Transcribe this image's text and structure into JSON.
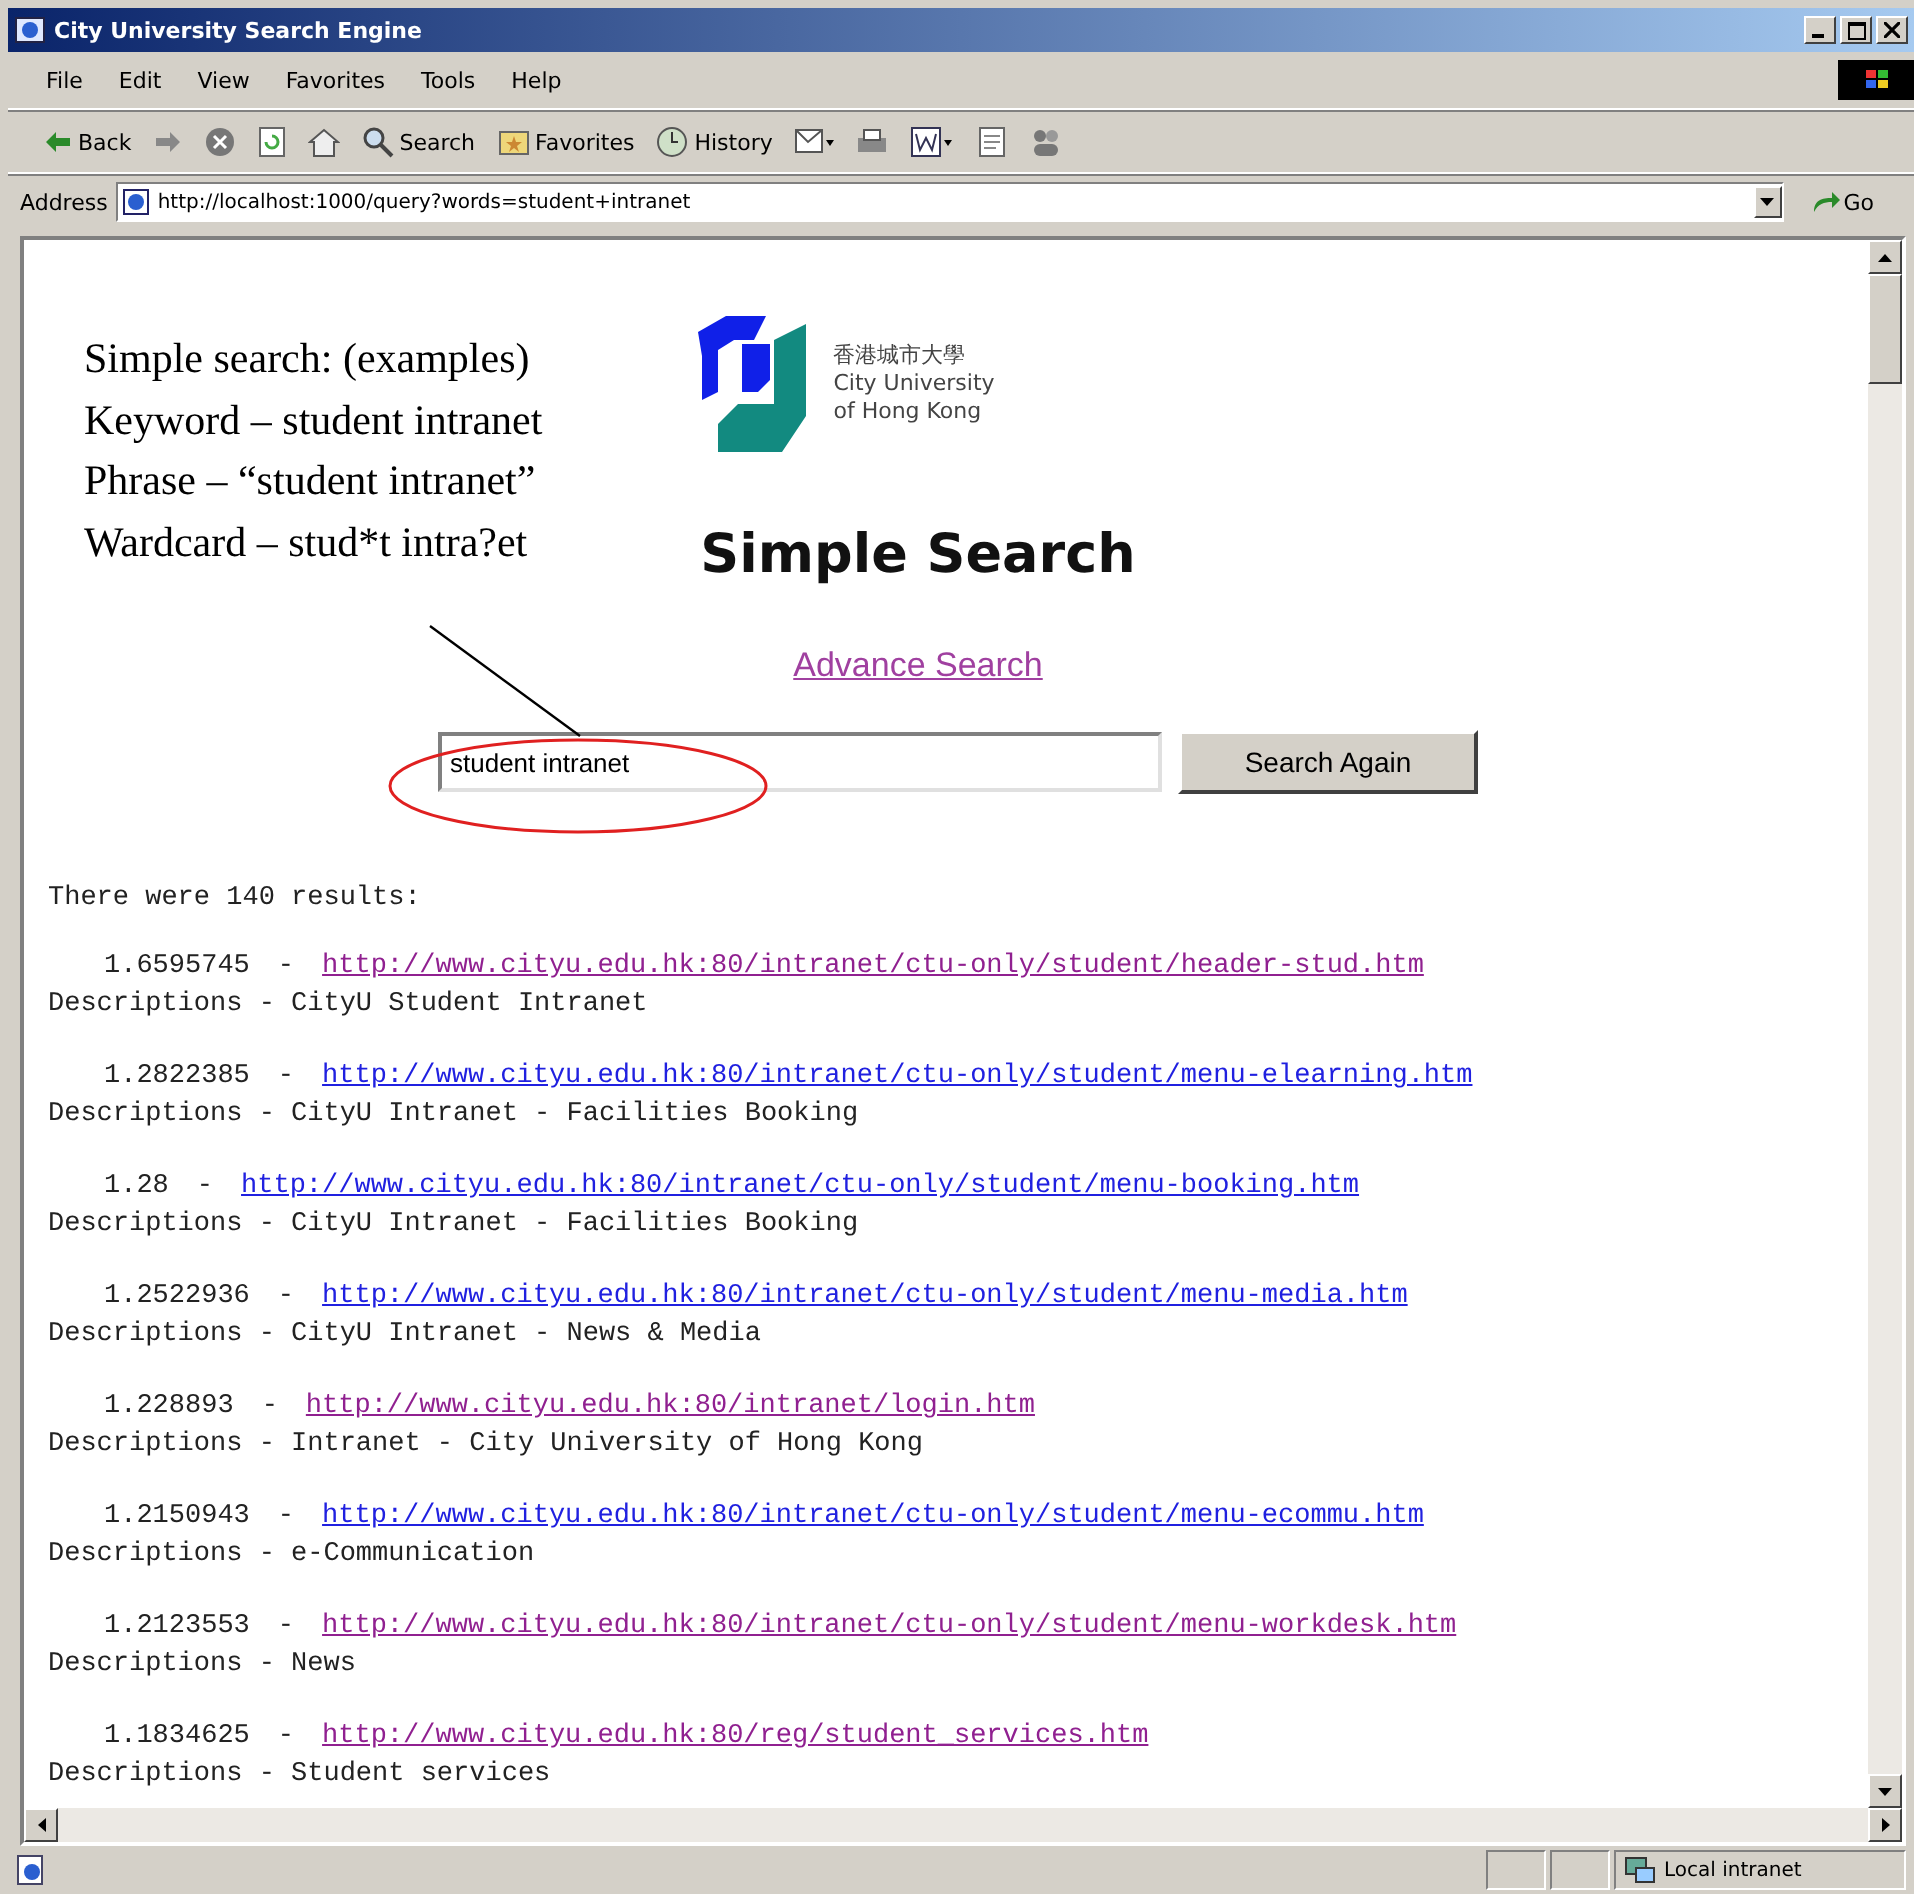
{
  "window": {
    "title": "City University Search Engine"
  },
  "menu": [
    "File",
    "Edit",
    "View",
    "Favorites",
    "Tools",
    "Help"
  ],
  "toolbar": [
    {
      "kind": "back",
      "label": "Back"
    },
    {
      "kind": "forward"
    },
    {
      "kind": "stop"
    },
    {
      "kind": "refresh"
    },
    {
      "kind": "home"
    },
    {
      "kind": "search",
      "label": "Search"
    },
    {
      "kind": "favorites",
      "label": "Favorites"
    },
    {
      "kind": "history",
      "label": "History"
    },
    {
      "kind": "mail"
    },
    {
      "kind": "print"
    },
    {
      "kind": "edit"
    },
    {
      "kind": "discuss"
    },
    {
      "kind": "messenger"
    }
  ],
  "address": {
    "label": "Address",
    "value": "http://localhost:1000/query?words=student+intranet",
    "go": "Go"
  },
  "annotation": [
    "Simple search: (examples)",
    "Keyword – student intranet",
    "Phrase – “student intranet”",
    "Wardcard – stud*t intra?et"
  ],
  "logo": {
    "chinese": "香港城市大學",
    "name_lines": [
      "City University",
      "of Hong Kong"
    ]
  },
  "heading": "Simple Search",
  "advance_link": "Advance Search",
  "search": {
    "value": "student intranet",
    "button": "Search Again"
  },
  "summary": "There were 140 results:",
  "results": [
    {
      "score": "1.6595745",
      "separator": "-",
      "url": "http://www.cityu.edu.hk:80/intranet/ctu-only/student/header-stud.htm",
      "visited": true,
      "description": "Descriptions - CityU Student Intranet"
    },
    {
      "score": "1.2822385",
      "separator": "-",
      "url": "http://www.cityu.edu.hk:80/intranet/ctu-only/student/menu-elearning.htm",
      "visited": false,
      "description": "Descriptions - CityU Intranet - Facilities Booking"
    },
    {
      "score": "1.28",
      "separator": "-",
      "url": "http://www.cityu.edu.hk:80/intranet/ctu-only/student/menu-booking.htm",
      "visited": false,
      "description": "Descriptions - CityU Intranet - Facilities Booking"
    },
    {
      "score": "1.2522936",
      "separator": "-",
      "url": "http://www.cityu.edu.hk:80/intranet/ctu-only/student/menu-media.htm",
      "visited": false,
      "description": "Descriptions - CityU Intranet - News & Media"
    },
    {
      "score": "1.228893",
      "separator": "-",
      "url": "http://www.cityu.edu.hk:80/intranet/login.htm",
      "visited": true,
      "description": "Descriptions - Intranet - City University of Hong Kong"
    },
    {
      "score": "1.2150943",
      "separator": "-",
      "url": "http://www.cityu.edu.hk:80/intranet/ctu-only/student/menu-ecommu.htm",
      "visited": false,
      "description": "Descriptions - e-Communication"
    },
    {
      "score": "1.2123553",
      "separator": "-",
      "url": "http://www.cityu.edu.hk:80/intranet/ctu-only/student/menu-workdesk.htm",
      "visited": true,
      "description": "Descriptions - News"
    },
    {
      "score": "1.1834625",
      "separator": "-",
      "url": "http://www.cityu.edu.hk:80/reg/student_services.htm",
      "visited": true,
      "description": "Descriptions - Student services"
    }
  ],
  "status_bar": {
    "zone": "Local intranet"
  }
}
